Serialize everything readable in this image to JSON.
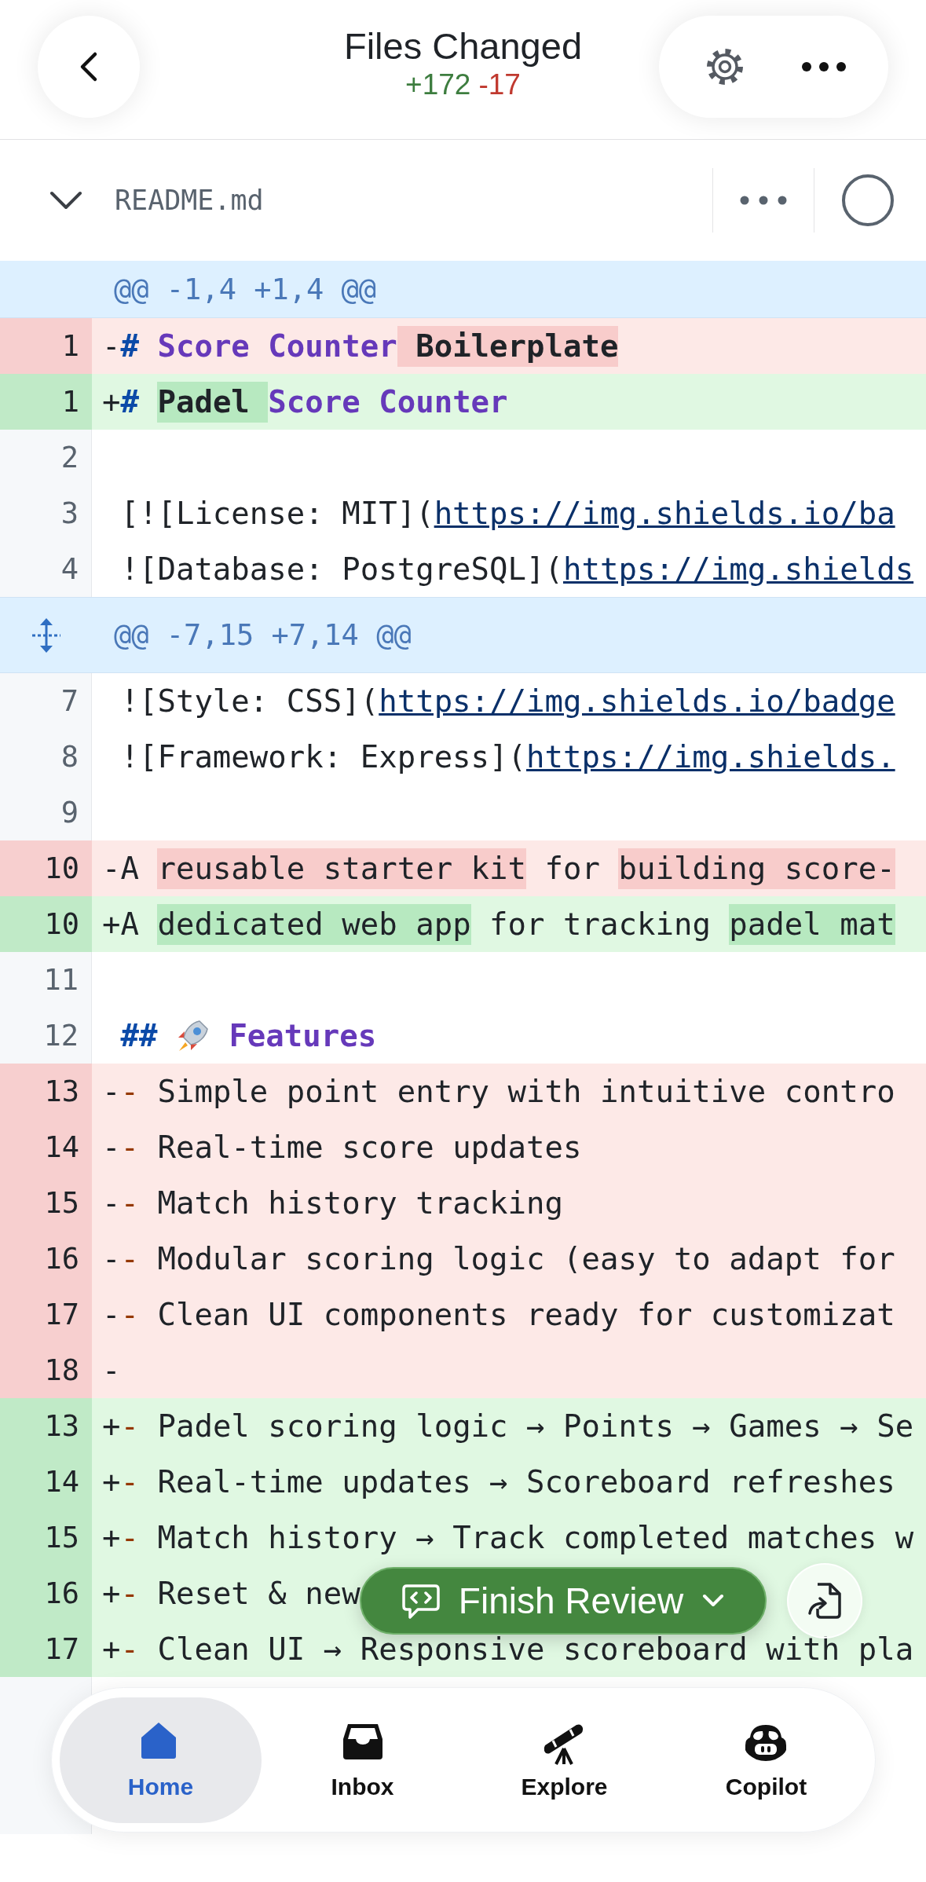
{
  "header": {
    "title": "Files Changed",
    "additions": "+172",
    "deletions": "-17"
  },
  "file": {
    "name": "README.md",
    "expanded": true,
    "viewed": false
  },
  "lines": [
    {
      "kind": "hunk",
      "text": "@@ -1,4 +1,4 @@",
      "expandable": false
    },
    {
      "kind": "del",
      "number": "1",
      "segments": [
        {
          "text": "-"
        },
        {
          "text": "#",
          "kind": "marker"
        },
        {
          "text": " Score Counter",
          "kind": "heading"
        },
        {
          "text": " Boilerplate",
          "kind": "strong",
          "changed": true
        }
      ]
    },
    {
      "kind": "add",
      "number": "1",
      "segments": [
        {
          "text": "+"
        },
        {
          "text": "# ",
          "kind": "marker"
        },
        {
          "text": "Padel ",
          "kind": "strong",
          "changed": true
        },
        {
          "text": "Score Counter",
          "kind": "heading"
        }
      ]
    },
    {
      "kind": "context",
      "number": "2"
    },
    {
      "kind": "context",
      "number": "3",
      "segments": [
        {
          "text": "[![License: MIT]("
        },
        {
          "text": "https://img.shields.io/ba",
          "kind": "link"
        }
      ]
    },
    {
      "kind": "context",
      "number": "4",
      "segments": [
        {
          "text": "![Database: PostgreSQL]("
        },
        {
          "text": "https://img.shields",
          "kind": "link"
        }
      ]
    },
    {
      "kind": "hunk",
      "text": "@@ -7,15 +7,14 @@",
      "expandable": true
    },
    {
      "kind": "context",
      "number": "7",
      "segments": [
        {
          "text": "![Style: CSS]("
        },
        {
          "text": "https://img.shields.io/badge",
          "kind": "link"
        }
      ]
    },
    {
      "kind": "context",
      "number": "8",
      "segments": [
        {
          "text": "![Framework: Express]("
        },
        {
          "text": "https://img.shields.",
          "kind": "link"
        }
      ]
    },
    {
      "kind": "context",
      "number": "9"
    },
    {
      "kind": "del",
      "number": "10",
      "segments": [
        {
          "text": "-A "
        },
        {
          "text": "reusable starter kit",
          "changed": true
        },
        {
          "text": " for "
        },
        {
          "text": "building score-",
          "changed": true
        }
      ]
    },
    {
      "kind": "add",
      "number": "10",
      "segments": [
        {
          "text": "+A "
        },
        {
          "text": "dedicated web app",
          "changed": true
        },
        {
          "text": " for tracking "
        },
        {
          "text": "padel mat",
          "changed": true
        }
      ]
    },
    {
      "kind": "context",
      "number": "11"
    },
    {
      "kind": "context",
      "number": "12",
      "segments": [
        {
          "text": "##",
          "kind": "marker"
        },
        {
          "kind": "rocket"
        },
        {
          "text": "Features",
          "kind": "heading"
        }
      ]
    },
    {
      "kind": "del",
      "number": "13",
      "segments": [
        {
          "text": "-"
        },
        {
          "text": "-",
          "kind": "bullet"
        },
        {
          "text": " Simple point entry with intuitive contro"
        }
      ]
    },
    {
      "kind": "del",
      "number": "14",
      "segments": [
        {
          "text": "-"
        },
        {
          "text": "-",
          "kind": "bullet"
        },
        {
          "text": " Real-time score updates"
        }
      ]
    },
    {
      "kind": "del",
      "number": "15",
      "segments": [
        {
          "text": "-"
        },
        {
          "text": "-",
          "kind": "bullet"
        },
        {
          "text": " Match history tracking"
        }
      ]
    },
    {
      "kind": "del",
      "number": "16",
      "segments": [
        {
          "text": "-"
        },
        {
          "text": "-",
          "kind": "bullet"
        },
        {
          "text": " Modular scoring logic (easy to adapt for"
        }
      ]
    },
    {
      "kind": "del",
      "number": "17",
      "segments": [
        {
          "text": "-"
        },
        {
          "text": "-",
          "kind": "bullet"
        },
        {
          "text": " Clean UI components ready for customizat"
        }
      ]
    },
    {
      "kind": "del",
      "number": "18",
      "segments": [
        {
          "text": "-"
        }
      ]
    },
    {
      "kind": "add",
      "number": "13",
      "segments": [
        {
          "text": "+"
        },
        {
          "text": "-",
          "kind": "bullet"
        },
        {
          "text": " Padel scoring logic → Points → Games → Se"
        }
      ]
    },
    {
      "kind": "add",
      "number": "14",
      "segments": [
        {
          "text": "+"
        },
        {
          "text": "-",
          "kind": "bullet"
        },
        {
          "text": " Real-time updates → Scoreboard refreshes"
        }
      ]
    },
    {
      "kind": "add",
      "number": "15",
      "segments": [
        {
          "text": "+"
        },
        {
          "text": "-",
          "kind": "bullet"
        },
        {
          "text": " Match history → Track completed matches w"
        }
      ]
    },
    {
      "kind": "add",
      "number": "16",
      "segments": [
        {
          "text": "+"
        },
        {
          "text": "-",
          "kind": "bullet"
        },
        {
          "text": " Reset & new"
        }
      ]
    },
    {
      "kind": "add",
      "number": "17",
      "segments": [
        {
          "text": "+"
        },
        {
          "text": "-",
          "kind": "bullet"
        },
        {
          "text": " Clean UI → Responsive scoreboard with pla"
        }
      ]
    }
  ],
  "finish_button": {
    "label": "Finish Review"
  },
  "nav": [
    {
      "kind": "home",
      "label": "Home",
      "selected": true
    },
    {
      "kind": "inbox",
      "label": "Inbox",
      "selected": false
    },
    {
      "kind": "explore",
      "label": "Explore",
      "selected": false
    },
    {
      "kind": "copilot",
      "label": "Copilot",
      "selected": false
    }
  ]
}
